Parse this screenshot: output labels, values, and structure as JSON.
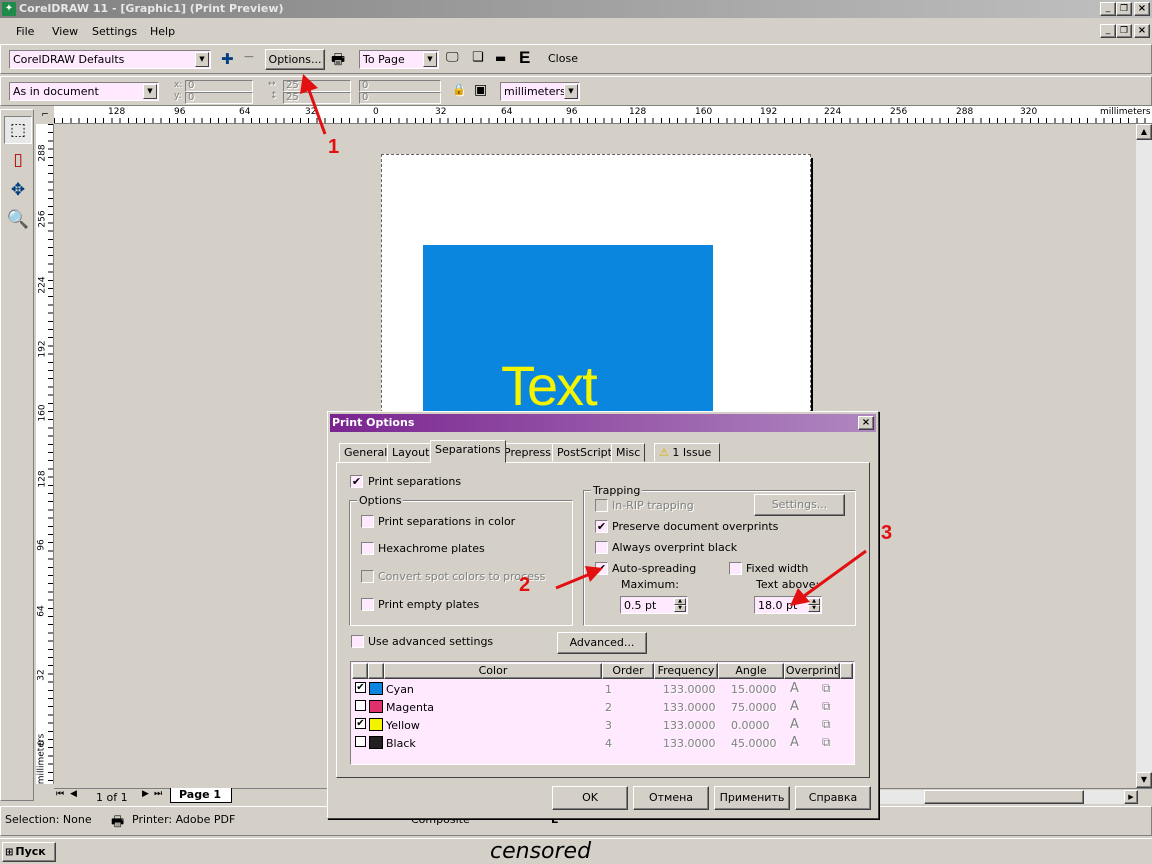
{
  "window": {
    "title": "CorelDRAW 11 - [Graphic1] (Print Preview)"
  },
  "menu": [
    "File",
    "View",
    "Settings",
    "Help"
  ],
  "toolbar1": {
    "preset": "CorelDRAW Defaults",
    "options_label": "Options...",
    "fit": "To Page",
    "e_label": "E",
    "close_label": "Close"
  },
  "toolbar2": {
    "position": "As in document",
    "x": "0",
    "y": "0",
    "x_label": "x:",
    "y_label": "y:",
    "w": "25",
    "h": "25",
    "sx": "0",
    "sy": "0",
    "units": "millimeters"
  },
  "ruler": {
    "h_ticks": [
      "128",
      "96",
      "64",
      "32",
      "0",
      "32",
      "64",
      "96",
      "128",
      "160",
      "192",
      "224",
      "256",
      "288",
      "320"
    ],
    "h_units": "millimeters",
    "v_ticks": [
      "288",
      "256",
      "224",
      "192",
      "160",
      "128",
      "96",
      "64",
      "32",
      "0"
    ],
    "v_units": "millimeters"
  },
  "page": {
    "text": "Text",
    "fill_color": "#0a86de",
    "text_color": "#f4f400"
  },
  "annotations": {
    "one": "1",
    "two": "2",
    "three": "3"
  },
  "page_nav": {
    "count": "1 of 1",
    "tab": "Page 1"
  },
  "status": {
    "selection": "Selection: None",
    "printer": "Printer: Adobe PDF",
    "mode": "Composite",
    "mode_marker": "E"
  },
  "taskbar": {
    "start": "Пуск",
    "caption": "censored"
  },
  "dialog": {
    "title": "Print Options",
    "tabs": [
      "General",
      "Layout",
      "Separations",
      "Prepress",
      "PostScript",
      "Misc",
      "1 Issue"
    ],
    "print_separations": "Print separations",
    "options_group": "Options",
    "print_in_color": "Print separations in color",
    "hexachrome": "Hexachrome plates",
    "convert_spot": "Convert spot colors to process",
    "print_empty": "Print empty plates",
    "trapping_group": "Trapping",
    "in_rip": "In-RIP trapping",
    "settings_button": "Settings...",
    "preserve": "Preserve document overprints",
    "always_black": "Always overprint black",
    "auto_spreading": "Auto-spreading",
    "fixed_width": "Fixed width",
    "maximum_label": "Maximum:",
    "maximum_value": "0.5 pt",
    "text_above_label": "Text above:",
    "text_above_value": "18.0 pt",
    "use_advanced": "Use advanced settings",
    "advanced_button": "Advanced...",
    "columns": [
      "Color",
      "Order",
      "Frequency",
      "Angle",
      "Overprint"
    ],
    "rows": [
      {
        "checked": true,
        "name": "Cyan",
        "color": "#0a86de",
        "order": "1",
        "frequency": "133.0000",
        "angle": "15.0000"
      },
      {
        "checked": false,
        "name": "Magenta",
        "color": "#e0306e",
        "order": "2",
        "frequency": "133.0000",
        "angle": "75.0000"
      },
      {
        "checked": true,
        "name": "Yellow",
        "color": "#f4f400",
        "order": "3",
        "frequency": "133.0000",
        "angle": "0.0000"
      },
      {
        "checked": false,
        "name": "Black",
        "color": "#231f20",
        "order": "4",
        "frequency": "133.0000",
        "angle": "45.0000"
      }
    ],
    "ok": "OK",
    "cancel": "Отмена",
    "apply": "Применить",
    "help": "Справка"
  }
}
